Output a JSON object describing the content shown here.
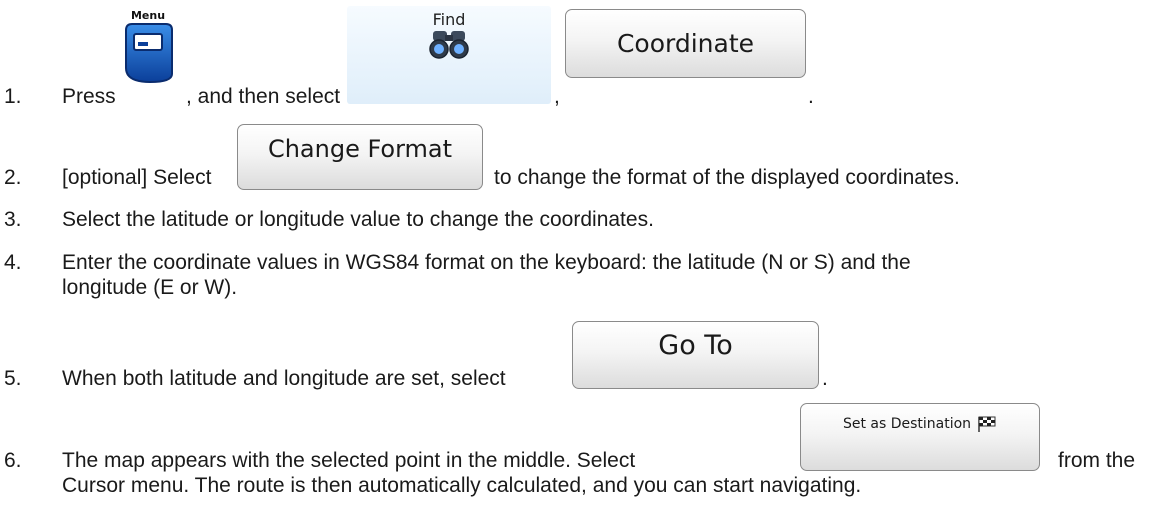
{
  "steps": [
    {
      "number": "1.",
      "text_a": "Press",
      "text_b": ", and then select",
      "text_c": ",",
      "text_d": "."
    },
    {
      "number": "2.",
      "text_a": "[optional] Select",
      "text_b": "to change the format of the displayed coordinates."
    },
    {
      "number": "3.",
      "text_a": "Select the latitude or longitude value to change the coordinates."
    },
    {
      "number": "4.",
      "line1": "Enter the coordinate values in WGS84 format on the keyboard: the latitude (N or S) and the",
      "line2": "longitude (E or W)."
    },
    {
      "number": "5.",
      "text_a": "When both latitude and longitude are set, select",
      "text_b": "."
    },
    {
      "number": "6.",
      "text_a": "The map appears with the selected point in the middle. Select",
      "text_b": "from the",
      "line2": "Cursor menu. The route is then automatically calculated, and you can start navigating."
    }
  ],
  "buttons": {
    "menu": "Menu",
    "find": "Find",
    "coordinate": "Coordinate",
    "change_format": "Change Format",
    "go_to": "Go To",
    "set_as_destination": "Set as Destination"
  },
  "icons": {
    "menu": "menu-icon",
    "find": "binoculars-icon",
    "destination": "checkered-flag-icon"
  }
}
